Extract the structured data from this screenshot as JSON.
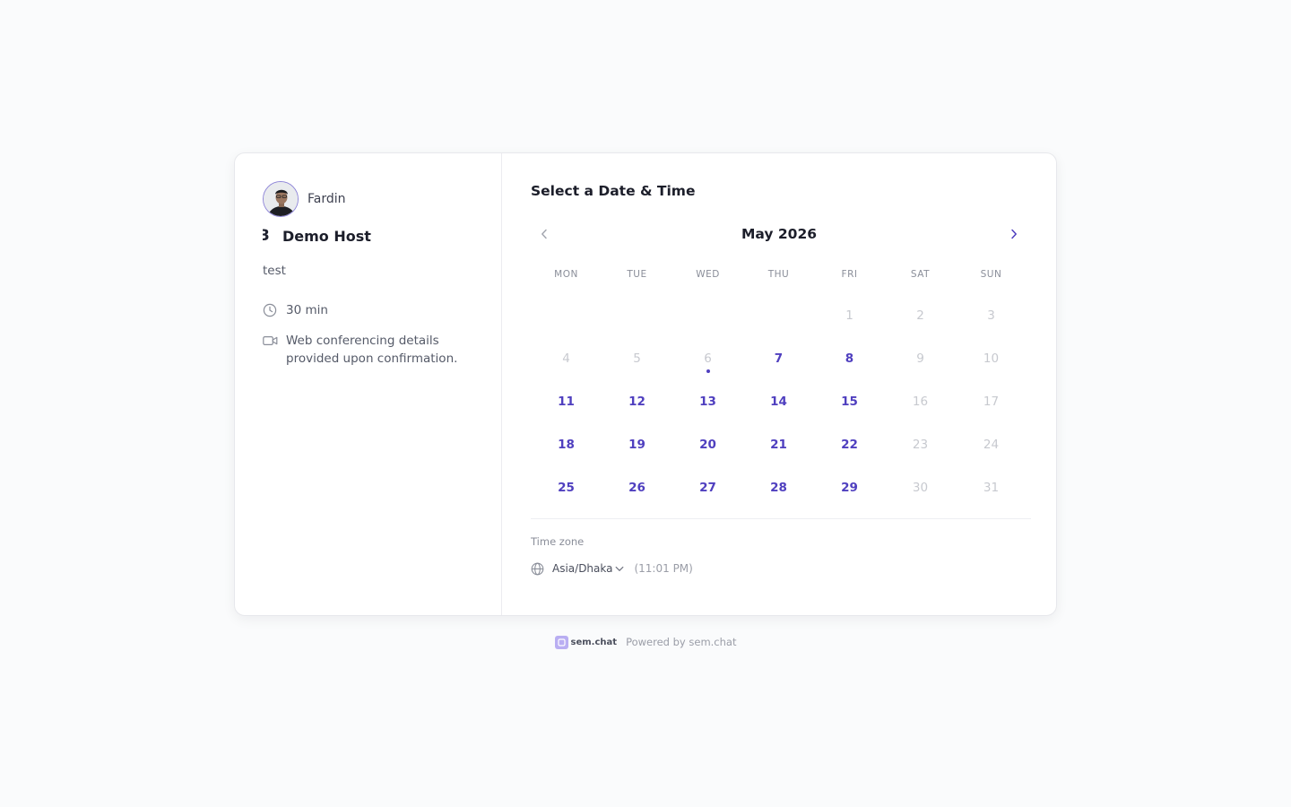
{
  "host": {
    "name": "Fardin"
  },
  "event": {
    "glyph": "3",
    "title": "Demo Host",
    "description": "test",
    "duration": "30 min",
    "location": "Web conferencing details provided upon confirmation."
  },
  "calendar": {
    "heading": "Select a Date & Time",
    "month_label": "May 2026",
    "weekdays": [
      "MON",
      "TUE",
      "WED",
      "THU",
      "FRI",
      "SAT",
      "SUN"
    ],
    "leading_blanks": 4,
    "days": [
      {
        "n": "1",
        "state": "disabled"
      },
      {
        "n": "2",
        "state": "disabled"
      },
      {
        "n": "3",
        "state": "disabled"
      },
      {
        "n": "4",
        "state": "disabled"
      },
      {
        "n": "5",
        "state": "disabled"
      },
      {
        "n": "6",
        "state": "today"
      },
      {
        "n": "7",
        "state": "available"
      },
      {
        "n": "8",
        "state": "available"
      },
      {
        "n": "9",
        "state": "disabled"
      },
      {
        "n": "10",
        "state": "disabled"
      },
      {
        "n": "11",
        "state": "available"
      },
      {
        "n": "12",
        "state": "available"
      },
      {
        "n": "13",
        "state": "available"
      },
      {
        "n": "14",
        "state": "available"
      },
      {
        "n": "15",
        "state": "available"
      },
      {
        "n": "16",
        "state": "disabled"
      },
      {
        "n": "17",
        "state": "disabled"
      },
      {
        "n": "18",
        "state": "available"
      },
      {
        "n": "19",
        "state": "available"
      },
      {
        "n": "20",
        "state": "available"
      },
      {
        "n": "21",
        "state": "available"
      },
      {
        "n": "22",
        "state": "available"
      },
      {
        "n": "23",
        "state": "disabled"
      },
      {
        "n": "24",
        "state": "disabled"
      },
      {
        "n": "25",
        "state": "available"
      },
      {
        "n": "26",
        "state": "available"
      },
      {
        "n": "27",
        "state": "available"
      },
      {
        "n": "28",
        "state": "available"
      },
      {
        "n": "29",
        "state": "available"
      },
      {
        "n": "30",
        "state": "disabled"
      },
      {
        "n": "31",
        "state": "disabled"
      }
    ]
  },
  "timezone": {
    "label": "Time zone",
    "value": "Asia/Dhaka",
    "current_time": "(11:01 PM)"
  },
  "footer": {
    "brand": "sem.chat",
    "powered_by": "Powered by sem.chat"
  },
  "icons": {
    "prev": "chevron-left-icon",
    "next": "chevron-right-icon",
    "clock": "clock-icon",
    "video": "video-camera-icon",
    "globe": "globe-icon",
    "dropdown": "chevron-down-icon"
  },
  "colors": {
    "accent": "#4f3fbf",
    "disabled": "#c7c9cf",
    "brand_logo": "#b9aef2"
  }
}
